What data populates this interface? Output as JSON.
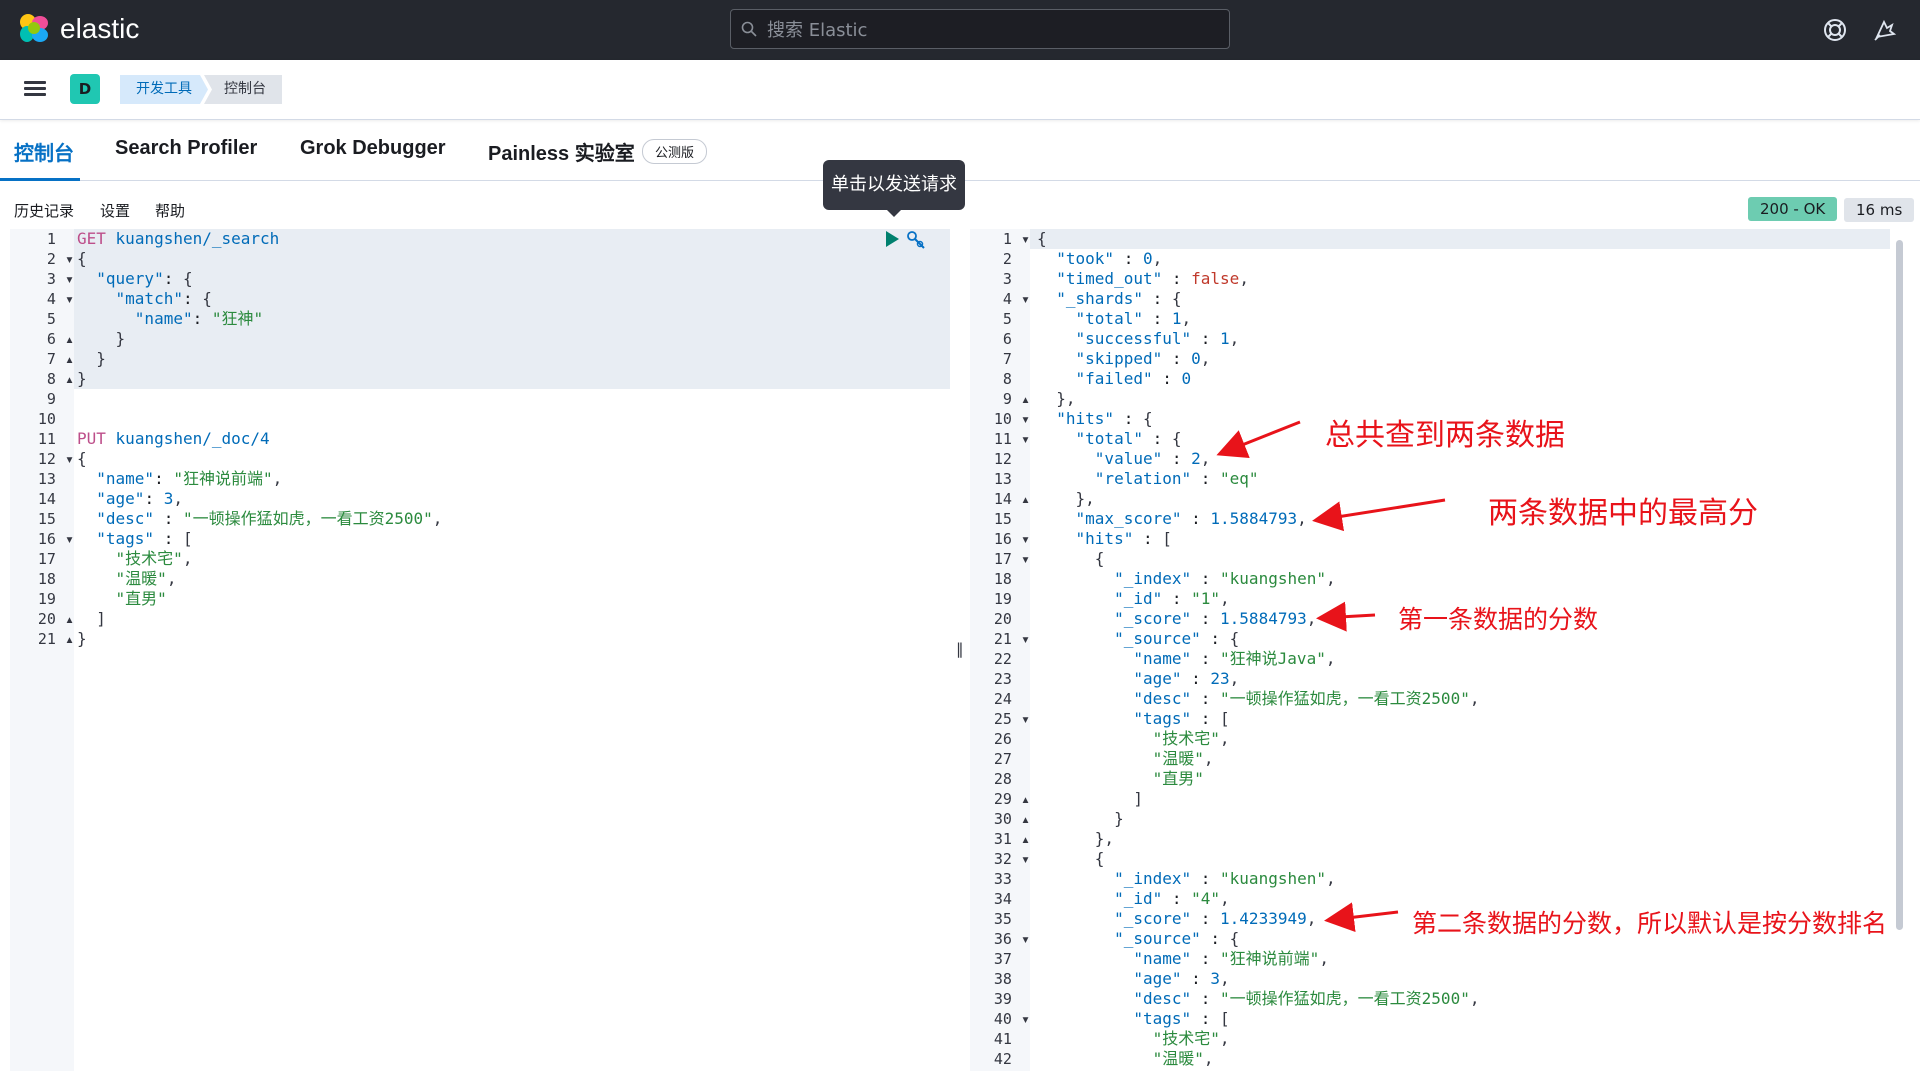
{
  "app": {
    "logo_text": "elastic",
    "search_placeholder": "搜索 Elastic"
  },
  "breadcrumb": [
    "开发工具",
    "控制台"
  ],
  "avatar": "D",
  "tabs": [
    {
      "label": "控制台"
    },
    {
      "label": "Search Profiler"
    },
    {
      "label": "Grok Debugger"
    },
    {
      "label": "Painless 实验室"
    }
  ],
  "beta_badge": "公测版",
  "menu": [
    "历史记录",
    "设置",
    "帮助"
  ],
  "status": "200 - OK",
  "timing": "16 ms",
  "tooltip": "单击以发送请求",
  "request_lines": [
    "GET kuangshen/_search",
    "{",
    "  \"query\": {",
    "    \"match\": {",
    "      \"name\": \"狂神\"",
    "    }",
    "  }",
    "}",
    "",
    "",
    "PUT kuangshen/_doc/4",
    "{",
    "  \"name\": \"狂神说前端\",",
    "  \"age\": 3,",
    "  \"desc\" : \"一顿操作猛如虎，一看工资2500\",",
    "  \"tags\" : [",
    "    \"技术宅\",",
    "    \"温暖\",",
    "    \"直男\"",
    "  ]",
    "}"
  ],
  "response_lines": [
    "{",
    "  \"took\" : 0,",
    "  \"timed_out\" : false,",
    "  \"_shards\" : {",
    "    \"total\" : 1,",
    "    \"successful\" : 1,",
    "    \"skipped\" : 0,",
    "    \"failed\" : 0",
    "  },",
    "  \"hits\" : {",
    "    \"total\" : {",
    "      \"value\" : 2,",
    "      \"relation\" : \"eq\"",
    "    },",
    "    \"max_score\" : 1.5884793,",
    "    \"hits\" : [",
    "      {",
    "        \"_index\" : \"kuangshen\",",
    "        \"_id\" : \"1\",",
    "        \"_score\" : 1.5884793,",
    "        \"_source\" : {",
    "          \"name\" : \"狂神说Java\",",
    "          \"age\" : 23,",
    "          \"desc\" : \"一顿操作猛如虎，一看工资2500\",",
    "          \"tags\" : [",
    "            \"技术宅\",",
    "            \"温暖\",",
    "            \"直男\"",
    "          ]",
    "        }",
    "      },",
    "      {",
    "        \"_index\" : \"kuangshen\",",
    "        \"_id\" : \"4\",",
    "        \"_score\" : 1.4233949,",
    "        \"_source\" : {",
    "          \"name\" : \"狂神说前端\",",
    "          \"age\" : 3,",
    "          \"desc\" : \"一顿操作猛如虎，一看工资2500\",",
    "          \"tags\" : [",
    "            \"技术宅\",",
    "            \"温暖\","
  ],
  "annotations": [
    {
      "text": "总共查到两条数据"
    },
    {
      "text": "两条数据中的最高分"
    },
    {
      "text": "第一条数据的分数"
    },
    {
      "text": "第二条数据的分数，所以默认是按分数排名"
    }
  ],
  "colors": {
    "accent": "#0771c5",
    "annotation": "#e8131a",
    "status_ok": "#6dccb1"
  }
}
